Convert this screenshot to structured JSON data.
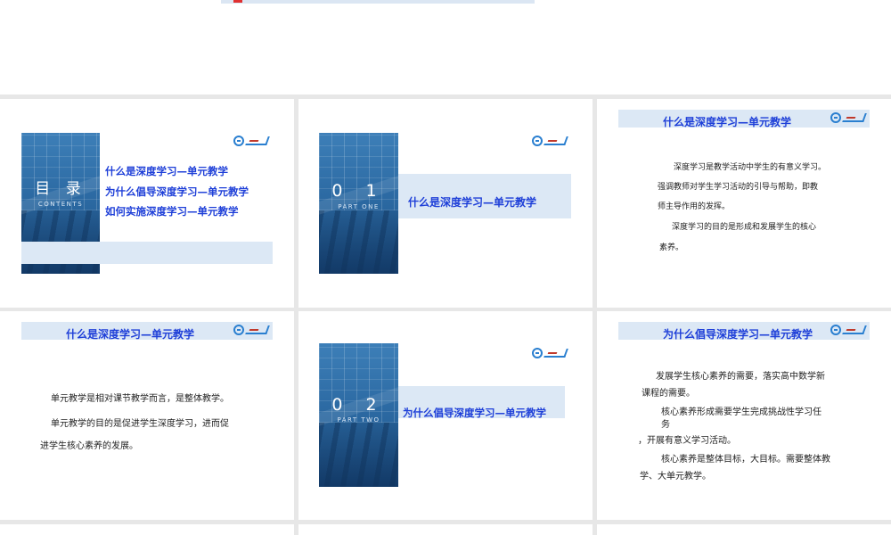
{
  "slides": {
    "contents": {
      "heading": "目 录",
      "heading_en": "CONTENTS",
      "items": [
        "什么是深度学习—单元教学",
        "为什么倡导深度学习—单元教学",
        "如何实施深度学习—单元教学"
      ]
    },
    "part_one": {
      "number": "0 1",
      "label": "PART ONE",
      "title": "什么是深度学习—单元教学"
    },
    "what_is": {
      "title": "什么是深度学习—单元教学",
      "lines": [
        "深度学习是教学活动中学生的有意义学习。",
        "强调教师对学生学习活动的引导与帮助，即教",
        "师主导作用的发挥。",
        "深度学习的目的是形成和发展学生的核心",
        "素养。"
      ]
    },
    "unit_teaching": {
      "title": "什么是深度学习—单元教学",
      "lines": [
        "单元教学是相对课节教学而言，是整体教学。",
        "单元教学的目的是促进学生深度学习，进而促",
        "进学生核心素养的发展。"
      ]
    },
    "part_two": {
      "number": "0 2",
      "label": "PART TWO",
      "title": "为什么倡导深度学习—单元教学"
    },
    "why": {
      "title": "为什么倡导深度学习—单元教学",
      "lines": [
        "发展学生核心素养的需要，落实高中数学新",
        "课程的需要。",
        "核心素养形成需要学生完成挑战性学习任",
        "务",
        "，开展有意义学习活动。",
        "核心素养是整体目标，大目标。需要整体教",
        "学、大单元教学。"
      ]
    }
  },
  "colors": {
    "accent": "#1e3fd8",
    "band": "#dce8f5",
    "photo": "#2c6aa3"
  }
}
